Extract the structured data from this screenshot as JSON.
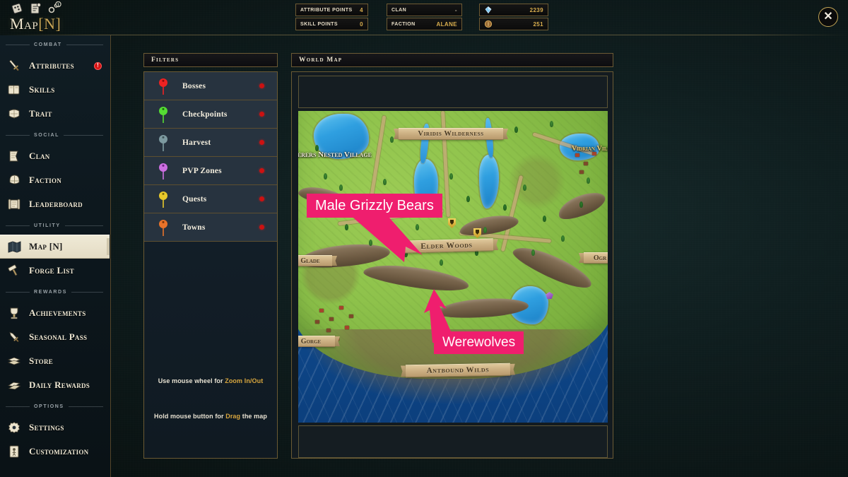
{
  "window": {
    "title": "Map [N]",
    "title_main": "Map",
    "title_key": "[N]",
    "close_label": "✕",
    "icons": [
      "dice-icon",
      "quest-log-icon",
      "settings-gear-icon"
    ],
    "quest_badge": "1"
  },
  "stats": {
    "left": [
      {
        "label": "Attribute Points",
        "value": "4",
        "dim": false
      },
      {
        "label": "Skill Points",
        "value": "0",
        "dim": false
      }
    ],
    "middle": [
      {
        "label": "Clan",
        "value": "-",
        "dim": true
      },
      {
        "label": "Faction",
        "value": "Alane",
        "dim": false
      }
    ],
    "currencies": [
      {
        "icon": "diamond-icon",
        "value": "2239",
        "color": "#7fc9f2"
      },
      {
        "icon": "coin-icon",
        "value": "251",
        "color": "#c08a46"
      }
    ]
  },
  "sidebar": {
    "sections": [
      {
        "label": "Combat",
        "items": [
          {
            "label": "Attributes",
            "icon": "sword-icon",
            "active": false,
            "alert": "!"
          },
          {
            "label": "Skills",
            "icon": "book-icon",
            "active": false,
            "alert": null
          },
          {
            "label": "Trait",
            "icon": "armor-icon",
            "active": false,
            "alert": null
          }
        ]
      },
      {
        "label": "Social",
        "items": [
          {
            "label": "Clan",
            "icon": "banner-icon",
            "active": false,
            "alert": null
          },
          {
            "label": "Faction",
            "icon": "helmet-icon",
            "active": false,
            "alert": null
          },
          {
            "label": "Leaderboard",
            "icon": "scroll-icon",
            "active": false,
            "alert": null
          }
        ]
      },
      {
        "label": "Utility",
        "items": [
          {
            "label": "Map [N]",
            "icon": "map-icon",
            "active": true,
            "alert": null
          },
          {
            "label": "Forge List",
            "icon": "hammer-icon",
            "active": false,
            "alert": null
          }
        ]
      },
      {
        "label": "Rewards",
        "items": [
          {
            "label": "Achievements",
            "icon": "trophy-icon",
            "active": false,
            "alert": null
          },
          {
            "label": "Seasonal Pass",
            "icon": "dagger-icon",
            "active": false,
            "alert": null
          },
          {
            "label": "Store",
            "icon": "crate-icon",
            "active": false,
            "alert": null
          },
          {
            "label": "Daily Rewards",
            "icon": "gift-icon",
            "active": false,
            "alert": null
          }
        ]
      },
      {
        "label": "Options",
        "items": [
          {
            "label": "Settings",
            "icon": "gear-icon",
            "active": false,
            "alert": null
          },
          {
            "label": "Customization",
            "icon": "character-card-icon",
            "active": false,
            "alert": null
          }
        ]
      }
    ]
  },
  "filters": {
    "header": "Filters",
    "rows": [
      {
        "label": "Bosses",
        "pin_color": "#ee2222",
        "enabled_dot": "#cc1111"
      },
      {
        "label": "Checkpoints",
        "pin_color": "#55dd33",
        "enabled_dot": "#cc1111"
      },
      {
        "label": "Harvest",
        "pin_color": "#7d9aa0",
        "enabled_dot": "#cc1111"
      },
      {
        "label": "PVP Zones",
        "pin_color": "#c濃",
        "enabled_dot": "#cc1111"
      },
      {
        "label": "Quests",
        "pin_color": "#e8c92b",
        "enabled_dot": "#cc1111"
      },
      {
        "label": "Towns",
        "pin_color": "#e8732a",
        "enabled_dot": "#cc1111"
      }
    ],
    "hints": [
      {
        "prefix": "Use mouse wheel for ",
        "accent": "Zoom In/Out",
        "suffix": ""
      },
      {
        "prefix": "Hold mouse button for ",
        "accent": "Drag",
        "suffix": " the map"
      }
    ]
  },
  "map": {
    "header": "World Map",
    "regions": [
      {
        "name": "Viridis Wilderness",
        "type": "banner"
      },
      {
        "name": "Elder Woods",
        "type": "banner"
      },
      {
        "name": "Antbound Wilds",
        "type": "banner"
      },
      {
        "name": "Glade",
        "type": "banner"
      },
      {
        "name": "Gorge",
        "type": "banner"
      },
      {
        "name": "Ogr",
        "type": "banner"
      }
    ],
    "places": [
      {
        "name": "Ferers Nested Village",
        "type": "village-label"
      },
      {
        "name": "Vidrian Village",
        "type": "village-label"
      }
    ],
    "callouts": [
      {
        "text": "Male Grizzly Bears",
        "color": "#ef1e6e"
      },
      {
        "text": "Werewolves",
        "color": "#ef1e6e"
      }
    ]
  },
  "colors": {
    "accent_gold": "#d8a63e",
    "frame_gold": "#6b5a34",
    "panel_dark": "#101a22",
    "filter_row": "#27333f",
    "active_item": "#e8e2cf",
    "callout_pink": "#ef1e6e",
    "alert_red": "#d81313",
    "background": "#0d1a1a"
  }
}
